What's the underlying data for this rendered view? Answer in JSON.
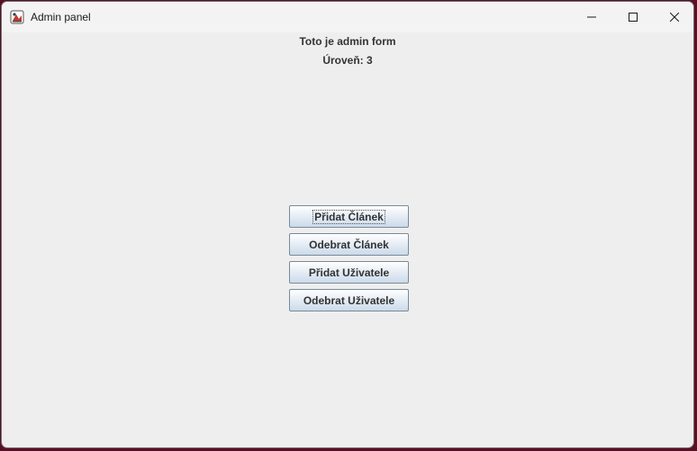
{
  "window": {
    "title": "Admin panel",
    "icon": "java-app-icon",
    "controls": {
      "minimize_icon": "minimize-icon",
      "maximize_icon": "maximize-icon",
      "close_icon": "close-icon"
    }
  },
  "content": {
    "heading": "Toto je admin form",
    "level_label": "Úroveň: 3"
  },
  "buttons": {
    "add_article": "Přidat Článek",
    "remove_article": "Odebrat Článek",
    "add_user": "Přidat Uživatele",
    "remove_user": "Odebrat Uživatele"
  },
  "colors": {
    "desktop_background": "#5a0f24",
    "window_background": "#eeeeee",
    "titlebar_background": "#f3f3f3",
    "button_border": "#7a8a99"
  }
}
